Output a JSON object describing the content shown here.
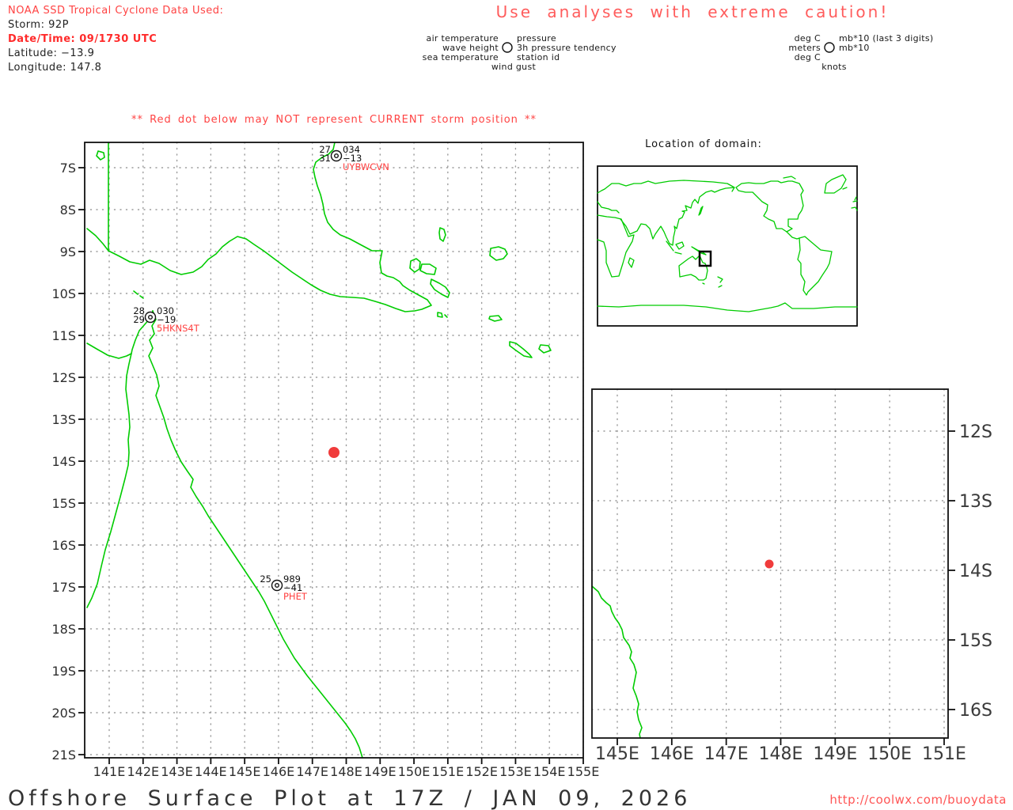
{
  "header": {
    "noaa_line": "NOAA SSD Tropical Cyclone Data Used:",
    "storm": "Storm: 92P",
    "datetime": "Date/Time: 09/1730 UTC",
    "latitude": "Latitude: −13.9",
    "longitude": "Longitude: 147.8",
    "caution": "Use analyses with extreme caution!"
  },
  "legend": {
    "left": {
      "row1_left": "air temperature",
      "row1_right": "pressure",
      "row2_left": "wave height",
      "row2_right": "3h pressure tendency",
      "row3_left": "sea temperature",
      "row3_right": "station id",
      "row4": "wind gust"
    },
    "right": {
      "row1_left": "deg C",
      "row1_right": "mb*10 (last 3 digits)",
      "row2_left": "meters",
      "row2_right": "mb*10",
      "row3_left": "deg C",
      "row4": "knots"
    }
  },
  "warning": "** Red dot below may NOT represent CURRENT storm position **",
  "main_map": {
    "x_ticks": [
      "141E",
      "142E",
      "143E",
      "144E",
      "145E",
      "146E",
      "147E",
      "148E",
      "149E",
      "150E",
      "151E",
      "152E",
      "153E",
      "154E",
      "155E"
    ],
    "y_ticks": [
      "7S",
      "8S",
      "9S",
      "10S",
      "11S",
      "12S",
      "13S",
      "14S",
      "15S",
      "16S",
      "17S",
      "18S",
      "19S",
      "20S",
      "21S"
    ],
    "stations": [
      {
        "id": "UYBWCVN",
        "upper_left": "27",
        "upper_right": "034",
        "left": "31",
        "right": "−13"
      },
      {
        "id": "5HKNS4T",
        "upper_left": "28",
        "upper_right": "030",
        "left": "29",
        "right": "−19"
      },
      {
        "id": "PHET",
        "upper_left": "25",
        "upper_right": "989",
        "left": "",
        "right": "−41"
      }
    ],
    "storm_dot": {
      "longitude": "147.8",
      "latitude": "-13.9"
    }
  },
  "inset": {
    "title": "Location of domain:"
  },
  "zoom_map": {
    "x_ticks": [
      "145E",
      "146E",
      "147E",
      "148E",
      "149E",
      "150E",
      "151E"
    ],
    "y_ticks": [
      "12S",
      "13S",
      "14S",
      "15S",
      "16S"
    ],
    "storm_dot": {
      "longitude": "147.8",
      "latitude": "-13.9"
    }
  },
  "footer": {
    "title": "Offshore Surface Plot at 17Z / JAN 09, 2026",
    "url": "http://coolwx.com/buoydata"
  },
  "colors": {
    "coastline": "#00cc00",
    "warning_red": "#ff4343",
    "storm_dot_red": "#f03b3b",
    "grid_gray": "#9a9a9a"
  }
}
